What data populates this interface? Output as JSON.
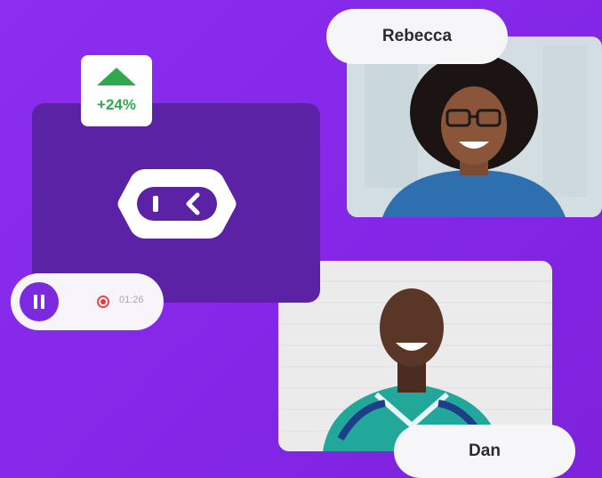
{
  "stat_card": {
    "value": "+24%",
    "icon": "up-arrow-icon",
    "color": "#2fa84f"
  },
  "recording": {
    "time": "01:26",
    "pause_icon": "pause-icon",
    "record_icon": "record-icon"
  },
  "participants": [
    {
      "name": "Rebecca"
    },
    {
      "name": "Dan"
    }
  ],
  "colors": {
    "background": "#8a2be2",
    "panel": "#5b22a6",
    "accent": "#7b2ae0",
    "positive": "#2fa84f",
    "record": "#e53935"
  }
}
